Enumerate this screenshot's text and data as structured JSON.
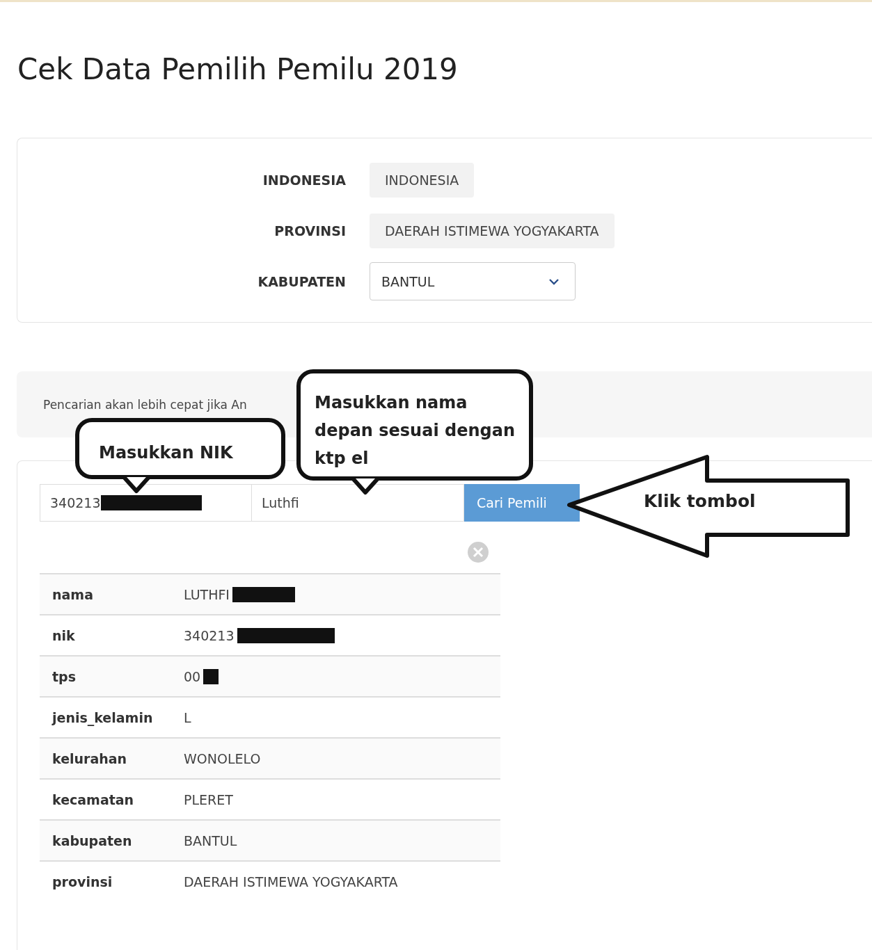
{
  "page": {
    "title": "Cek Data Pemilih Pemilu 2019"
  },
  "region": {
    "fields": [
      {
        "label": "INDONESIA",
        "value": "INDONESIA",
        "kind": "static"
      },
      {
        "label": "PROVINSI",
        "value": "DAERAH ISTIMEWA YOGYAKARTA",
        "kind": "static"
      },
      {
        "label": "KABUPATEN",
        "value": "BANTUL",
        "kind": "select"
      }
    ]
  },
  "notice": "Pencarian akan lebih cepat jika An",
  "search": {
    "nik": {
      "value": "340213",
      "redacted": true
    },
    "name": {
      "value": "Luthfi",
      "redacted": false
    },
    "button": "Cari Pemili"
  },
  "result": {
    "rows": [
      {
        "field": "nama",
        "value": "LUTHFI",
        "redacted": true
      },
      {
        "field": "nik",
        "value": "340213",
        "redacted": true
      },
      {
        "field": "tps",
        "value": "00",
        "redacted": true
      },
      {
        "field": "jenis_kelamin",
        "value": "L",
        "redacted": false
      },
      {
        "field": "kelurahan",
        "value": "WONOLELO",
        "redacted": false
      },
      {
        "field": "kecamatan",
        "value": "PLERET",
        "redacted": false
      },
      {
        "field": "kabupaten",
        "value": "BANTUL",
        "redacted": false
      },
      {
        "field": "provinsi",
        "value": "DAERAH ISTIMEWA YOGYAKARTA",
        "redacted": false
      }
    ]
  },
  "annotations": [
    {
      "kind": "callout",
      "text": "Masukkan NIK"
    },
    {
      "kind": "callout",
      "text": "Masukkan nama depan sesuai dengan ktp el"
    },
    {
      "kind": "arrow",
      "text": "Klik tombol"
    }
  ]
}
